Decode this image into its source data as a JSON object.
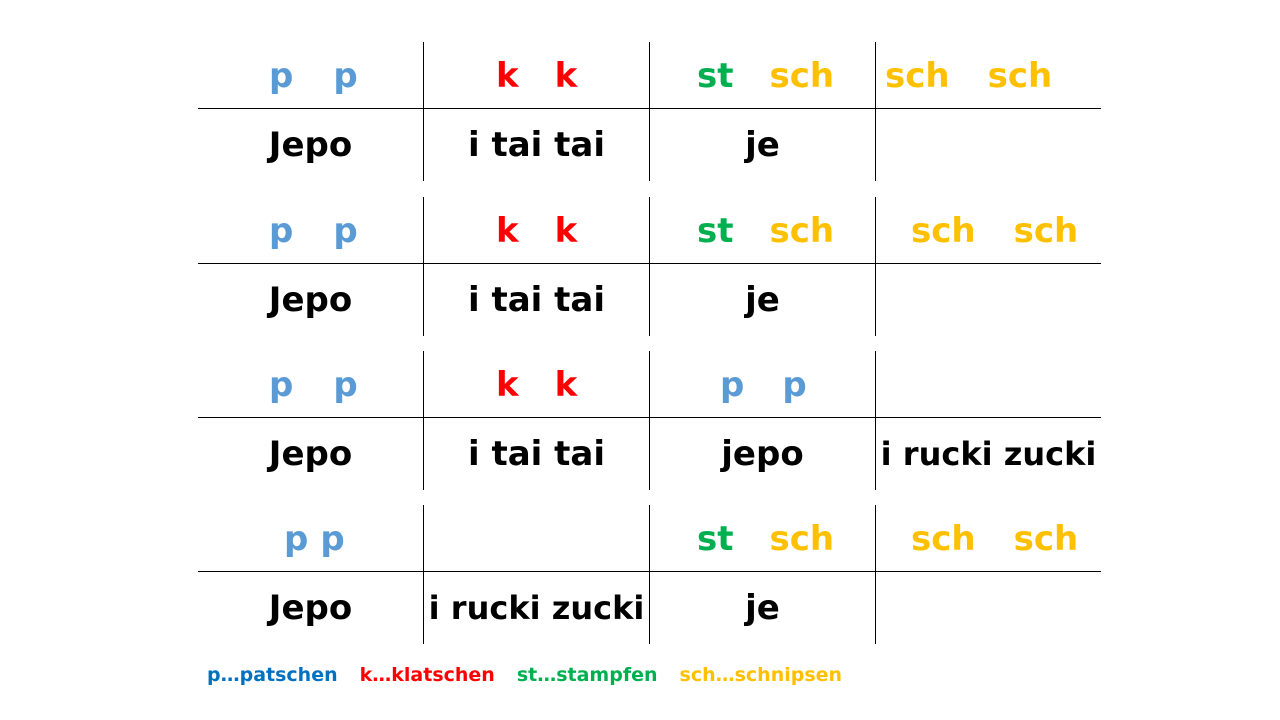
{
  "blocks": [
    {
      "symbols": [
        {
          "tokens": [
            {
              "t": "p",
              "c": "p"
            },
            {
              "t": "p",
              "c": "p"
            }
          ]
        },
        {
          "tokens": [
            {
              "t": "k",
              "c": "k"
            },
            {
              "t": "k",
              "c": "k"
            }
          ]
        },
        {
          "tokens": [
            {
              "t": "st",
              "c": "st"
            },
            {
              "t": "sch",
              "c": "sch"
            }
          ]
        },
        {
          "tokens": [
            {
              "t": "sch",
              "c": "sch"
            },
            {
              "t": "sch",
              "c": "sch"
            }
          ]
        }
      ],
      "lyrics": [
        "Jepo",
        "i tai tai",
        "je",
        ""
      ]
    },
    {
      "symbols": [
        {
          "tokens": [
            {
              "t": "p",
              "c": "p"
            },
            {
              "t": "p",
              "c": "p"
            }
          ]
        },
        {
          "tokens": [
            {
              "t": "k",
              "c": "k"
            },
            {
              "t": "k",
              "c": "k"
            }
          ]
        },
        {
          "tokens": [
            {
              "t": "st",
              "c": "st"
            },
            {
              "t": "sch",
              "c": "sch"
            }
          ]
        },
        {
          "tokens": [
            {
              "t": "sch",
              "c": "sch"
            },
            {
              "t": "sch",
              "c": "sch"
            }
          ]
        }
      ],
      "lyrics": [
        "Jepo",
        "i tai tai",
        "je",
        ""
      ]
    },
    {
      "symbols": [
        {
          "tokens": [
            {
              "t": "p",
              "c": "p"
            },
            {
              "t": "p",
              "c": "p"
            }
          ]
        },
        {
          "tokens": [
            {
              "t": "k",
              "c": "k"
            },
            {
              "t": "k",
              "c": "k"
            }
          ]
        },
        {
          "tokens": [
            {
              "t": "p",
              "c": "p"
            },
            {
              "t": "p",
              "c": "p"
            }
          ]
        },
        {
          "tokens": []
        }
      ],
      "lyrics": [
        "Jepo",
        "i tai tai",
        "jepo",
        "i rucki zucki"
      ]
    },
    {
      "symbols": [
        {
          "tokens": [
            {
              "t": "p",
              "c": "p"
            },
            {
              "t": "p",
              "c": "p"
            }
          ]
        },
        {
          "tokens": []
        },
        {
          "tokens": [
            {
              "t": "st",
              "c": "st"
            },
            {
              "t": "sch",
              "c": "sch"
            }
          ]
        },
        {
          "tokens": [
            {
              "t": "sch",
              "c": "sch"
            },
            {
              "t": "sch",
              "c": "sch"
            }
          ]
        }
      ],
      "lyrics": [
        "Jepo",
        "i rucki zucki",
        "je",
        ""
      ]
    }
  ],
  "legend": {
    "p": "p…patschen",
    "k": "k…klatschen",
    "st": "st…stampfen",
    "sch": "sch…schnipsen"
  },
  "colors": {
    "p": "#5b9bd5",
    "k": "#ff0000",
    "st": "#00b050",
    "sch": "#ffc000"
  }
}
